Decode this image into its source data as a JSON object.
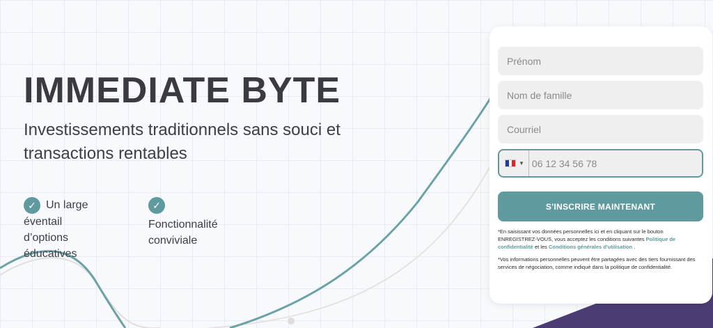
{
  "hero": {
    "title": "IMMEDIATE BYTE",
    "subtitle": "Investissements traditionnels sans souci et transactions rentables"
  },
  "features": [
    {
      "icon": "check-icon",
      "label": "Un large éventail d’options éducatives"
    },
    {
      "icon": "check-icon",
      "label": "Fonctionnalité conviviale"
    }
  ],
  "form": {
    "first_name_placeholder": "Prénom",
    "last_name_placeholder": "Nom de famille",
    "email_placeholder": "Courriel",
    "phone": {
      "country_flag": "flag-france-icon",
      "placeholder": "06 12 34 56 78"
    },
    "submit_label": "S'INSCRIRE MAINTENANT",
    "legal_1_text": "*En saisissant vos données personnelles ici et en cliquant sur le bouton ENREGISTREZ-VOUS, vous acceptez les conditions suivantes",
    "legal_1_link_privacy": "Politique de confidentialité",
    "legal_1_and": "et les",
    "legal_1_link_terms": "Conditions générales d'utilisation",
    "legal_1_end": ".",
    "legal_2_text": "*Vos informations personnelles peuvent être partagées avec des tiers fournissant des services de négociation, comme indiqué dans la politique de confidentialité."
  },
  "colors": {
    "accent": "#5e9a9e",
    "purple": "#4b3d73",
    "text": "#3a3a40"
  }
}
